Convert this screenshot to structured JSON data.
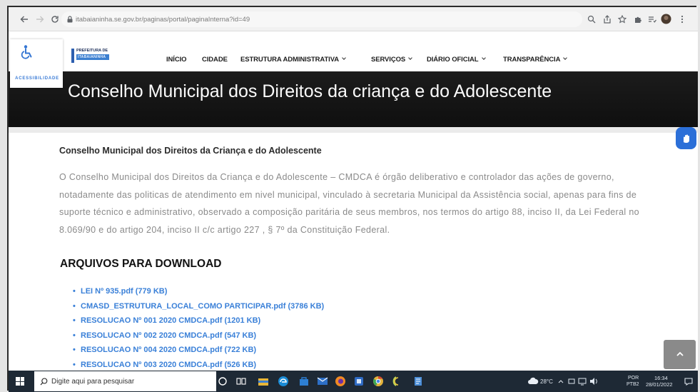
{
  "browser": {
    "url": "itabaianinha.se.gov.br/paginas/portal/paginaInterna?id=49",
    "icons": [
      "back-arrow-icon",
      "forward-arrow-icon",
      "reload-icon",
      "lock-icon",
      "zoom-icon",
      "share-icon",
      "star-icon",
      "extensions-icon",
      "reading-list-icon",
      "profile-avatar-icon",
      "menu-dots-icon"
    ]
  },
  "site": {
    "accessibility_label": "ACESSIBILIDADE",
    "logo": {
      "line1": "PREFEITURA DE",
      "line2": "ITABAIANINHA"
    },
    "nav": [
      {
        "label": "INÍCIO",
        "dropdown": false
      },
      {
        "label": "CIDADE",
        "dropdown": false
      },
      {
        "label": "ESTRUTURA ADMINISTRATIVA",
        "dropdown": true
      },
      {
        "label": "SERVIÇOS",
        "dropdown": true
      },
      {
        "label": "DIÁRIO OFICIAL",
        "dropdown": true
      },
      {
        "label": "TRANSPARÊNCIA",
        "dropdown": true
      }
    ],
    "banner_title": "Conselho Municipal dos Direitos da criança e do Adolescente"
  },
  "content": {
    "heading": "Conselho Municipal dos Direitos da Criança e do Adolescente",
    "paragraph": "O Conselho Municipal dos Direitos da Criança e do Adolescente – CMDCA é órgão deliberativo e controlador das ações de governo, notadamente das politicas de atendimento em nivel municipal, vinculado à secretaria Municipal da Assistência social, apenas para fins de suporte técnico e administrativo, observado a composição paritária de seus membros, nos termos do artigo 88, inciso II, da Lei Federal no 8.069/90 e do artigo 204, inciso II c/c artigo 227 , § 7º da Constituição Federal.",
    "downloads_title": "ARQUIVOS PARA DOWNLOAD",
    "files": [
      {
        "label": "LEI Nº 935.pdf (779 KB)"
      },
      {
        "label": "CMASD_ESTRUTURA_LOCAL_COMO PARTICIPAR.pdf (3786 KB)"
      },
      {
        "label": "RESOLUCAO Nº 001 2020 CMDCA.pdf (1201 KB)"
      },
      {
        "label": "RESOLUCAO Nº 002 2020 CMDCA.pdf (547 KB)"
      },
      {
        "label": "RESOLUCAO Nº 004 2020 CMDCA.pdf (722 KB)"
      },
      {
        "label": "RESOLUCAO Nº 003 2020 CMDCA.pdf (526 KB)"
      }
    ]
  },
  "taskbar": {
    "search_placeholder": "Digite aqui para pesquisar",
    "weather": "28°C",
    "language": "POR",
    "keyboard": "PTB2",
    "time": "16:34",
    "date": "28/01/2022"
  },
  "colors": {
    "banner": "#161616",
    "link": "#3a80d8",
    "vlibras_button": "#2b6fd8",
    "scroll_top_button": "#8a8a8a",
    "taskbar": "#1e2935"
  }
}
